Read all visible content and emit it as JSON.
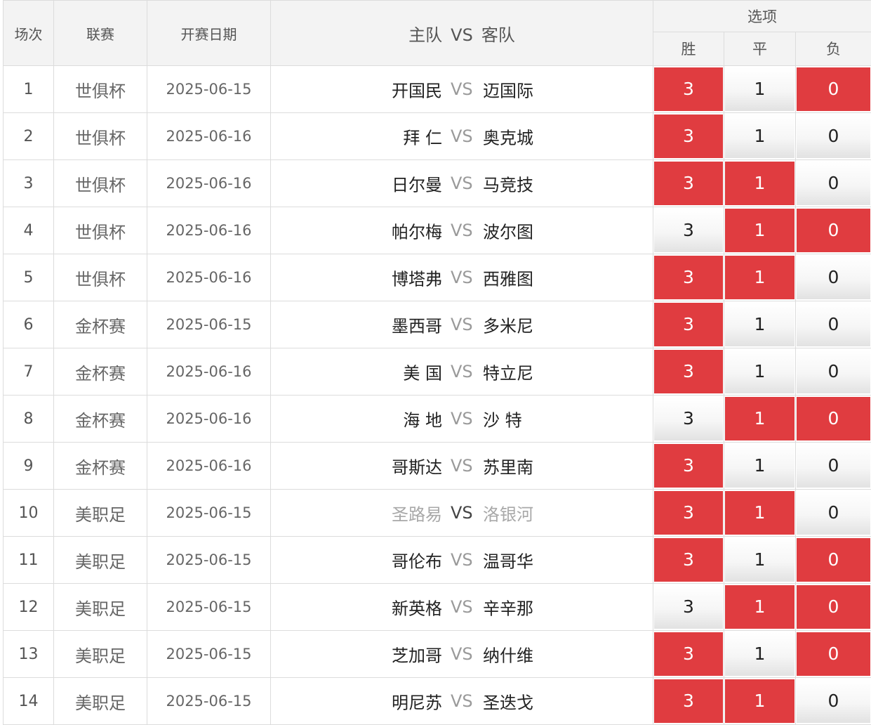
{
  "header": {
    "col_index": "场次",
    "col_league": "联赛",
    "col_date": "开赛日期",
    "col_home": "主队",
    "col_vs": "VS",
    "col_away": "客队",
    "col_options": "选项",
    "opt_win": "胜",
    "opt_draw": "平",
    "opt_lose": "负"
  },
  "colors": {
    "selected": "#e03c40",
    "border": "#dcdcdc",
    "header_bg": "#f3f3f3"
  },
  "rows": [
    {
      "no": "1",
      "league": "世俱杯",
      "date": "2025-06-15",
      "home": "开国民",
      "vs": "VS",
      "away": "迈国际",
      "win": "3",
      "draw": "1",
      "lose": "0",
      "sel": [
        true,
        false,
        true
      ],
      "dim": false
    },
    {
      "no": "2",
      "league": "世俱杯",
      "date": "2025-06-16",
      "home": "拜 仁",
      "vs": "VS",
      "away": "奥克城",
      "win": "3",
      "draw": "1",
      "lose": "0",
      "sel": [
        true,
        false,
        false
      ],
      "dim": false
    },
    {
      "no": "3",
      "league": "世俱杯",
      "date": "2025-06-16",
      "home": "日尔曼",
      "vs": "VS",
      "away": "马竞技",
      "win": "3",
      "draw": "1",
      "lose": "0",
      "sel": [
        true,
        true,
        false
      ],
      "dim": false
    },
    {
      "no": "4",
      "league": "世俱杯",
      "date": "2025-06-16",
      "home": "帕尔梅",
      "vs": "VS",
      "away": "波尔图",
      "win": "3",
      "draw": "1",
      "lose": "0",
      "sel": [
        false,
        true,
        true
      ],
      "dim": false
    },
    {
      "no": "5",
      "league": "世俱杯",
      "date": "2025-06-16",
      "home": "博塔弗",
      "vs": "VS",
      "away": "西雅图",
      "win": "3",
      "draw": "1",
      "lose": "0",
      "sel": [
        true,
        true,
        false
      ],
      "dim": false
    },
    {
      "no": "6",
      "league": "金杯赛",
      "date": "2025-06-15",
      "home": "墨西哥",
      "vs": "VS",
      "away": "多米尼",
      "win": "3",
      "draw": "1",
      "lose": "0",
      "sel": [
        true,
        false,
        false
      ],
      "dim": false
    },
    {
      "no": "7",
      "league": "金杯赛",
      "date": "2025-06-16",
      "home": "美 国",
      "vs": "VS",
      "away": "特立尼",
      "win": "3",
      "draw": "1",
      "lose": "0",
      "sel": [
        true,
        false,
        false
      ],
      "dim": false
    },
    {
      "no": "8",
      "league": "金杯赛",
      "date": "2025-06-16",
      "home": "海 地",
      "vs": "VS",
      "away": "沙 特",
      "win": "3",
      "draw": "1",
      "lose": "0",
      "sel": [
        false,
        true,
        true
      ],
      "dim": false
    },
    {
      "no": "9",
      "league": "金杯赛",
      "date": "2025-06-16",
      "home": "哥斯达",
      "vs": "VS",
      "away": "苏里南",
      "win": "3",
      "draw": "1",
      "lose": "0",
      "sel": [
        true,
        false,
        false
      ],
      "dim": false
    },
    {
      "no": "10",
      "league": "美职足",
      "date": "2025-06-15",
      "home": "圣路易",
      "vs": "VS",
      "away": "洛银河",
      "win": "3",
      "draw": "1",
      "lose": "0",
      "sel": [
        true,
        true,
        false
      ],
      "dim": true
    },
    {
      "no": "11",
      "league": "美职足",
      "date": "2025-06-15",
      "home": "哥伦布",
      "vs": "VS",
      "away": "温哥华",
      "win": "3",
      "draw": "1",
      "lose": "0",
      "sel": [
        true,
        false,
        true
      ],
      "dim": false
    },
    {
      "no": "12",
      "league": "美职足",
      "date": "2025-06-15",
      "home": "新英格",
      "vs": "VS",
      "away": "辛辛那",
      "win": "3",
      "draw": "1",
      "lose": "0",
      "sel": [
        false,
        true,
        true
      ],
      "dim": false
    },
    {
      "no": "13",
      "league": "美职足",
      "date": "2025-06-15",
      "home": "芝加哥",
      "vs": "VS",
      "away": "纳什维",
      "win": "3",
      "draw": "1",
      "lose": "0",
      "sel": [
        true,
        false,
        true
      ],
      "dim": false
    },
    {
      "no": "14",
      "league": "美职足",
      "date": "2025-06-15",
      "home": "明尼苏",
      "vs": "VS",
      "away": "圣迭戈",
      "win": "3",
      "draw": "1",
      "lose": "0",
      "sel": [
        true,
        true,
        false
      ],
      "dim": false
    }
  ]
}
